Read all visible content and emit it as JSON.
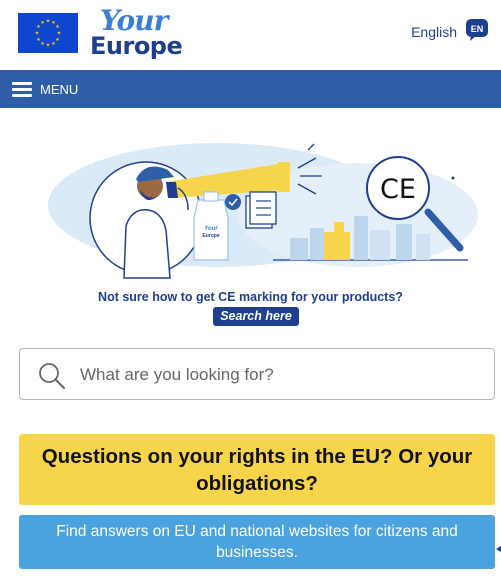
{
  "header": {
    "logo_your": "Your",
    "logo_europe": "Europe",
    "language_label": "English",
    "language_code": "EN"
  },
  "menu": {
    "label": "MENU"
  },
  "ce_banner": {
    "question": "Not sure how to get CE marking for your products?",
    "search_link": "Search here",
    "illustration_badge_your": "Your",
    "illustration_badge_europe": "Europe",
    "illustration_ce_mark": "CE"
  },
  "search": {
    "placeholder": "What are you looking for?",
    "value": ""
  },
  "rights_box": {
    "title": "Questions on your rights in the EU? Or your obligations?"
  },
  "answers_box": {
    "text": "Find answers on EU and national websites for citizens and businesses."
  },
  "colors": {
    "menu_bar": "#2e5ea8",
    "brand_dark_blue": "#1e3f8f",
    "eu_flag_blue": "#0e47cb",
    "eu_star_yellow": "#ffcc00",
    "rights_box_yellow": "#f7d54a",
    "answers_box_blue": "#4aa3de"
  },
  "icons": [
    "eu-flag-icon",
    "language-bubble-icon",
    "hamburger-icon",
    "search-icon"
  ]
}
